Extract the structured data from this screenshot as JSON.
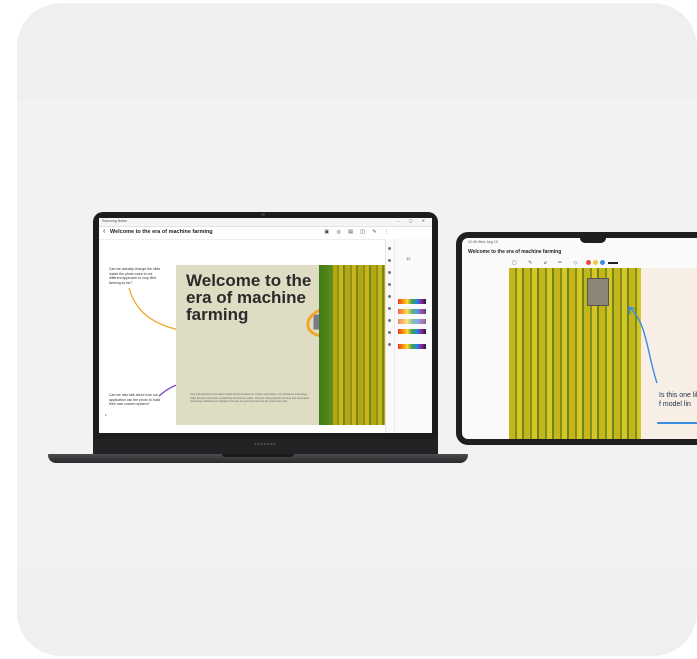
{
  "laptop": {
    "window_app_name": "Samsung Notes",
    "window_controls": "–  ▢  ✕",
    "note_title": "Welcome to the era of machine farming",
    "back_icon": "chevron-left-icon",
    "header_tools": "▣ ◎ ▤ ◫ ✎ ⋮",
    "side_note_1": "Can we actually change the slide inside the photo more to our different approach to crop field farming so far?",
    "side_note_2": "Can we also talk about how our application can the photo to build their own custom system?",
    "side_page_number": "1",
    "slide_title": "Welcome to the era of machine farming",
    "slide_body": "Stay informed about the latest trends and innovations in modern agriculture. Our advanced technology helps farmers boost their productivity and reduce waste. Discover how precision farming and automated harvesting machines are changing the way we grow food around the world every day.",
    "brand": "SAMSUNG",
    "font_size_value": "12",
    "circle_color": "#f0a72a",
    "arrow_color_1": "#f0a72a",
    "arrow_color_2": "#7b3fc4"
  },
  "tablet": {
    "status_time": "12:45 Wed, Aug 19",
    "note_title": "Welcome to the era of machine farming",
    "back_icon": "chevron-left-icon",
    "tools": "▢ ✎ ⌀ ✏ ◇",
    "note_text": "Is this one like it is f model lin",
    "arrow_color": "#3a8ce0"
  }
}
